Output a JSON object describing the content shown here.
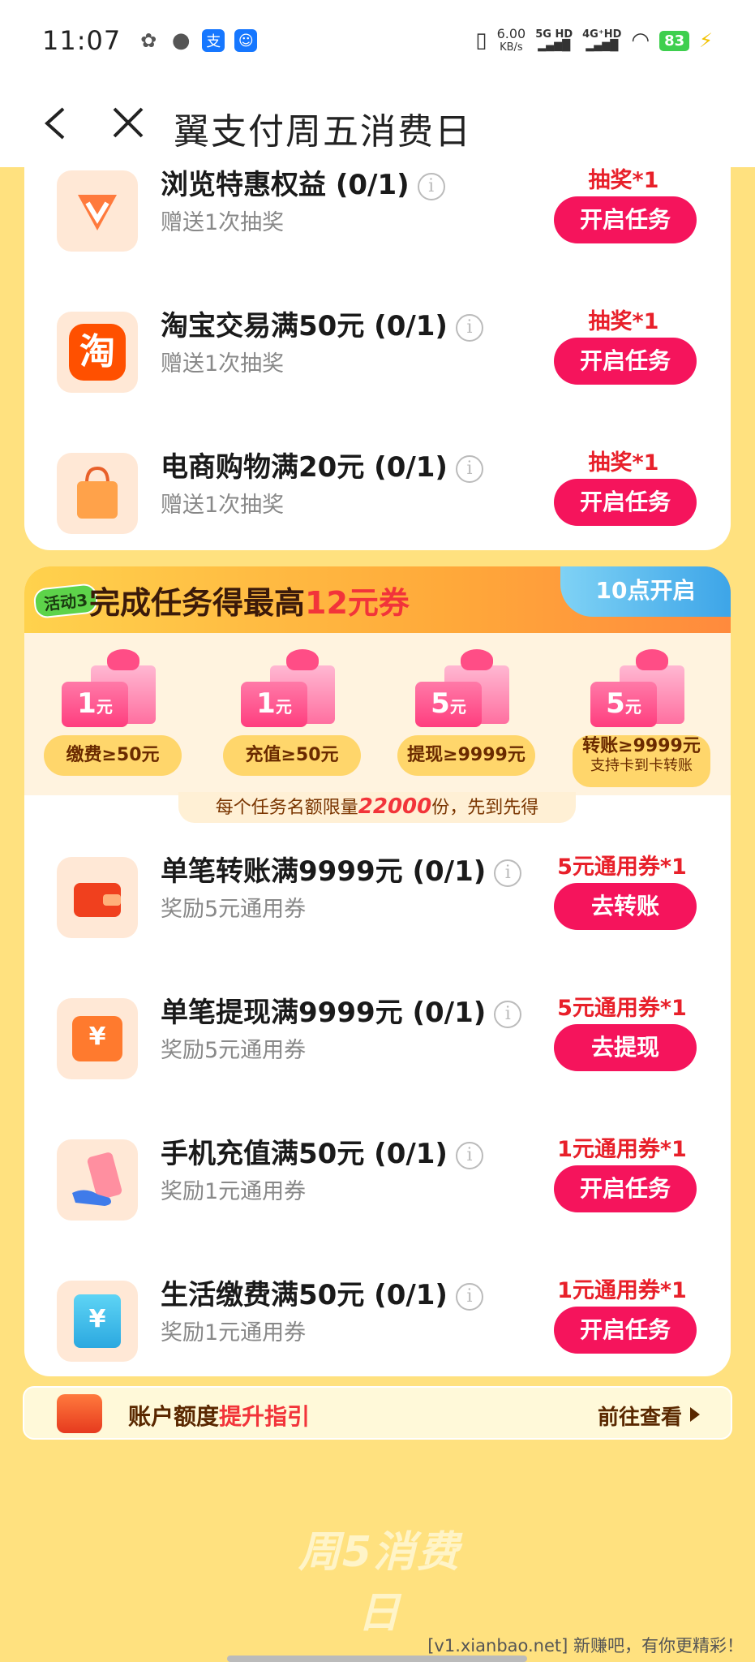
{
  "status_bar": {
    "time": "11:07",
    "net_speed_value": "6.00",
    "net_speed_unit": "KB/s",
    "signal1": "5G HD",
    "signal2": "4G⁺HD",
    "battery": "83"
  },
  "nav": {
    "title": "翼支付周五消费日"
  },
  "top_tasks": [
    {
      "title": "浏览特惠权益 (0/1)",
      "sub": "赠送1次抽奖",
      "reward": "抽奖*1",
      "button": "开启任务",
      "icon": "v-badge-icon"
    },
    {
      "title": "淘宝交易满50元 (0/1)",
      "sub": "赠送1次抽奖",
      "reward": "抽奖*1",
      "button": "开启任务",
      "icon": "taobao-icon"
    },
    {
      "title": "电商购物满20元 (0/1)",
      "sub": "赠送1次抽奖",
      "reward": "抽奖*1",
      "button": "开启任务",
      "icon": "shopping-bag-icon"
    }
  ],
  "activity3": {
    "badge": "活动3",
    "title_prefix": "完成任务得最高",
    "title_highlight": "12元券",
    "open_time": "10点开启",
    "coupons": [
      {
        "amount": "1",
        "unit": "元",
        "label": "缴费≥50元",
        "sub": ""
      },
      {
        "amount": "1",
        "unit": "元",
        "label": "充值≥50元",
        "sub": ""
      },
      {
        "amount": "5",
        "unit": "元",
        "label": "提现≥9999元",
        "sub": ""
      },
      {
        "amount": "5",
        "unit": "元",
        "label": "转账≥9999元",
        "sub": "支持卡到卡转账"
      }
    ],
    "quota_prefix": "每个任务名额限量",
    "quota_num": "22000",
    "quota_suffix": "份，先到先得",
    "tasks": [
      {
        "title": "单笔转账满9999元 (0/1)",
        "sub": "奖励5元通用券",
        "reward": "5元通用券*1",
        "button": "去转账",
        "icon": "wallet-icon"
      },
      {
        "title": "单笔提现满9999元 (0/1)",
        "sub": "奖励5元通用券",
        "reward": "5元通用券*1",
        "button": "去提现",
        "icon": "withdraw-icon"
      },
      {
        "title": "手机充值满50元 (0/1)",
        "sub": "奖励1元通用券",
        "reward": "1元通用券*1",
        "button": "开启任务",
        "icon": "phone-recharge-icon"
      },
      {
        "title": "生活缴费满50元 (0/1)",
        "sub": "奖励1元通用券",
        "reward": "1元通用券*1",
        "button": "开启任务",
        "icon": "bill-icon"
      }
    ]
  },
  "guide": {
    "text_prefix": "账户额度",
    "text_highlight": "提升指引",
    "link": "前往查看"
  },
  "footer_logo": "周5消费日",
  "watermark": "[v1.xianbao.net] 新赚吧，有你更精彩！",
  "colors": {
    "page_bg": "#FFE17F",
    "button": "#F5145C",
    "reward": "#E8202A"
  }
}
